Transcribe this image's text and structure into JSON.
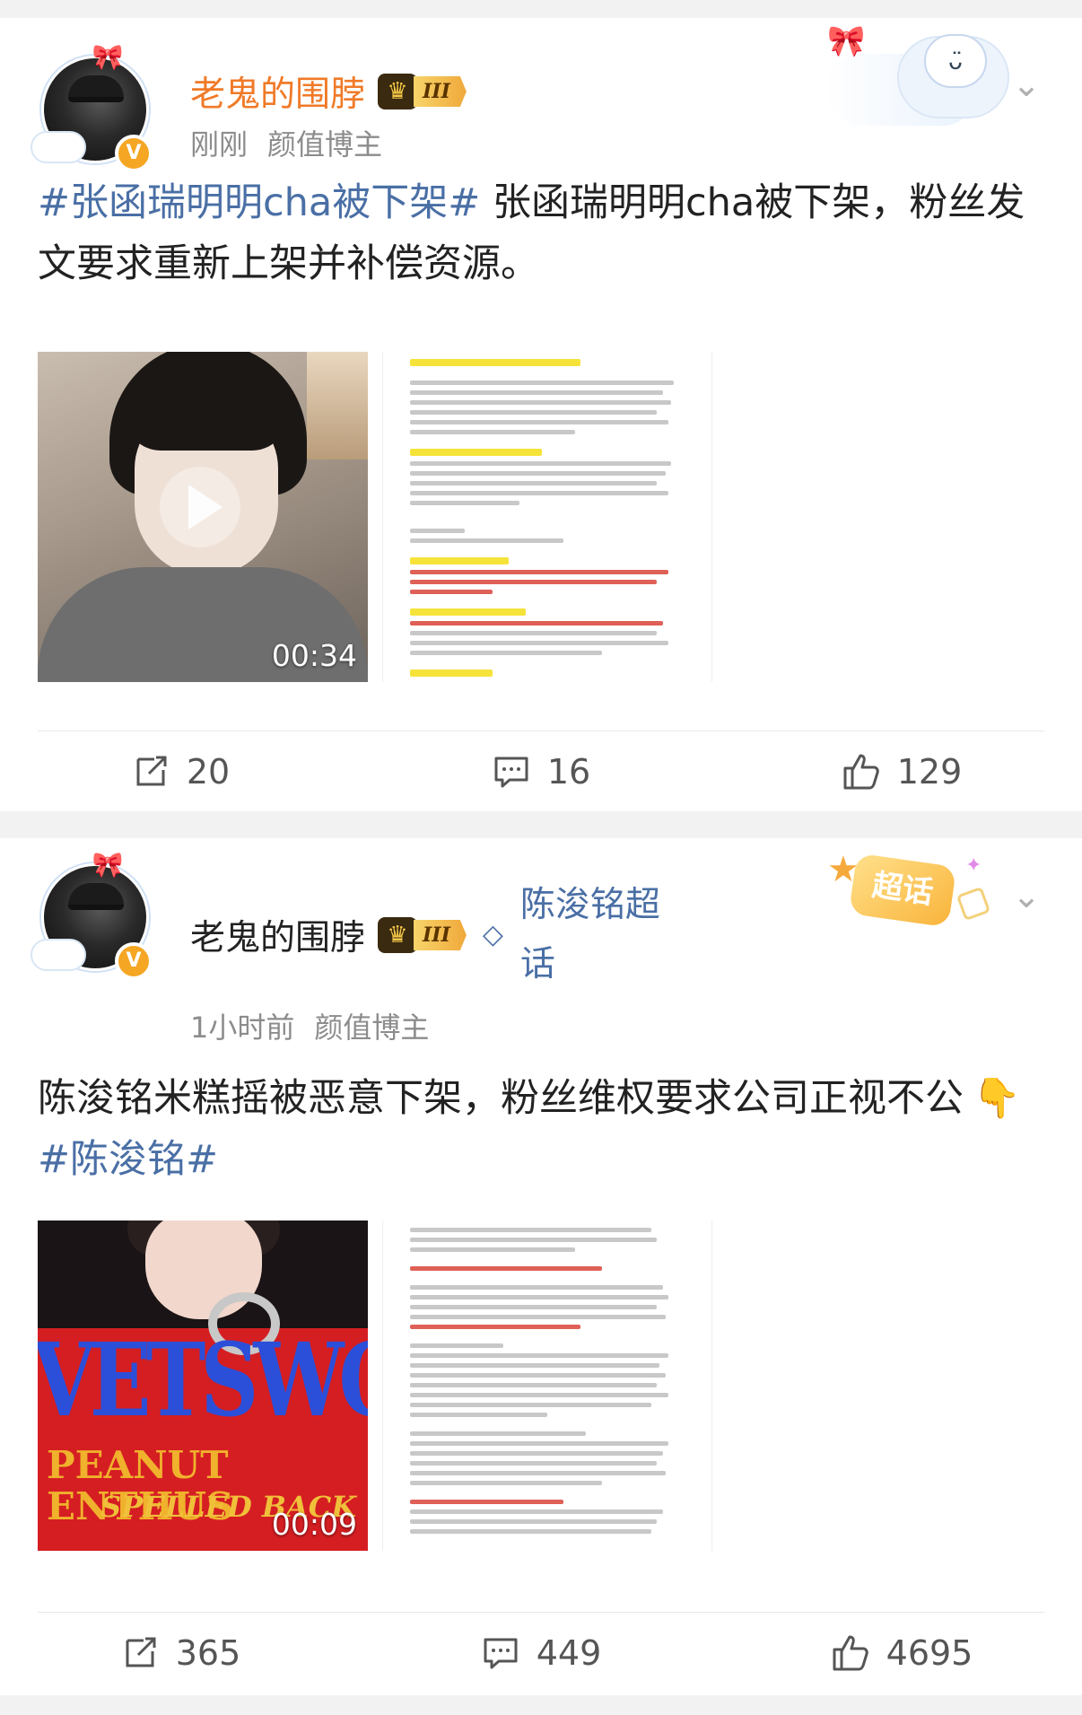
{
  "posts": [
    {
      "author": "老鬼的围脖",
      "vip_level": "III",
      "time": "刚刚",
      "tag": "颜值博主",
      "text_topic": "#张函瑞明明cha被下架#",
      "text_body": " 张函瑞明明cha被下架，粉丝发文要求重新上架并补偿资源。",
      "video_duration": "00:34",
      "repost_count": "20",
      "comment_count": "16",
      "like_count": "129"
    },
    {
      "author": "老鬼的围脖",
      "vip_level": "III",
      "supertopic": "陈浚铭超话",
      "supertopic_badge": "超话",
      "time": "1小时前",
      "tag": "颜值博主",
      "text_body": "陈浚铭米糕摇被恶意下架，粉丝维权要求公司正视不公",
      "text_emoji": "👇",
      "text_topic": "#陈浚铭#",
      "video_duration": "00:09",
      "video_shirt_text_1": "VETSWOR",
      "video_shirt_text_2": "PEANUT ENTHUS",
      "video_shirt_text_3": "SPELLED BACK",
      "repost_count": "365",
      "comment_count": "449",
      "like_count": "4695"
    }
  ],
  "icons": {
    "repost": "repost-icon",
    "comment": "comment-icon",
    "like": "like-icon",
    "more": "chevron-down-icon",
    "verified": "verified-badge-icon",
    "play": "play-icon"
  },
  "colors": {
    "author_orange": "#f07a28",
    "topic_blue": "#4a6fa5",
    "meta_gray": "#8c8c8c"
  }
}
